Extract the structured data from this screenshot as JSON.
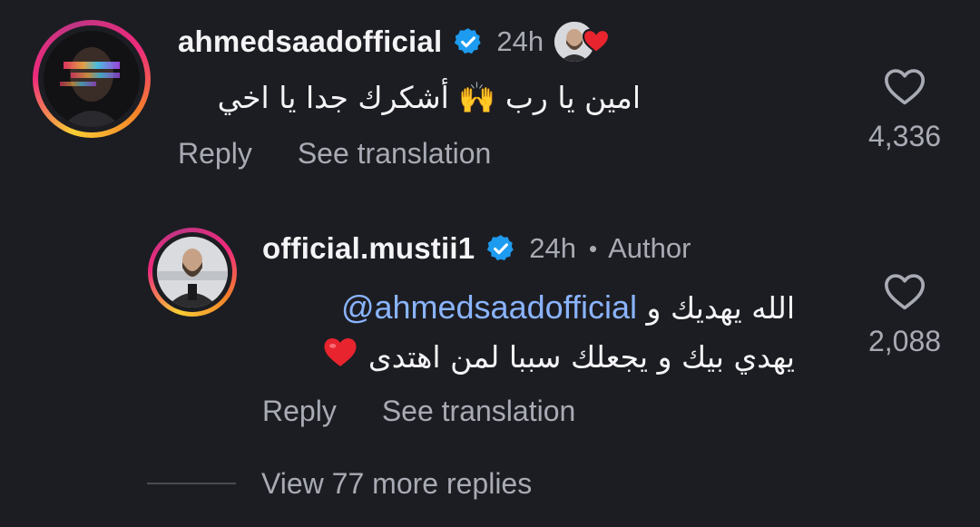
{
  "comment": {
    "username": "ahmedsaadofficial",
    "time": "24h",
    "text": "امين يا رب 🙌 أشكرك جدا يا اخي",
    "like_count": "4,336",
    "actions": {
      "reply": "Reply",
      "see_translation": "See translation"
    }
  },
  "reply": {
    "username": "official.mustii1",
    "time": "24h",
    "separator": "•",
    "badge": "Author",
    "mention": "@ahmedsaadofficial",
    "text_line1_suffix": "الله يهديك و",
    "text_line2": "يهدي بيك و يجعلك سببا لمن اهتدى",
    "like_count": "2,088",
    "actions": {
      "reply": "Reply",
      "see_translation": "See translation"
    }
  },
  "view_more": {
    "label": "View 77 more replies"
  },
  "colors": {
    "background": "#1c1d22",
    "text_primary": "#f4f4f6",
    "text_secondary": "#a8abb4",
    "verified_blue": "#1d9bf0",
    "mention_blue": "#8ab4ff",
    "heart_red": "#e8242f"
  },
  "icons": {
    "verified": "verified-badge-icon",
    "like": "heart-outline-icon",
    "creator_liked": "red-heart-icon",
    "raising_hands": "raising-hands-emoji",
    "red_heart_emoji": "red-heart-emoji"
  }
}
